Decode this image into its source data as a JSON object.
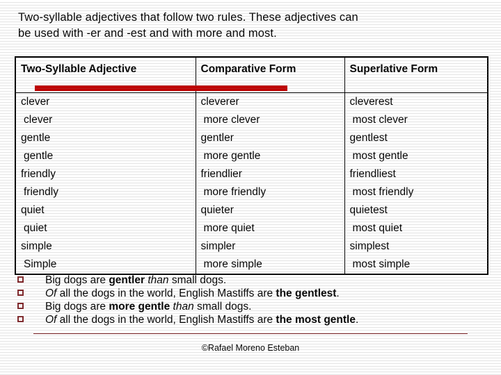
{
  "slide": {
    "title": "Two-syllable adjectives that follow two rules. These adjectives can\nbe used with -er and -est and with more and most.",
    "accent_red": "#C00000",
    "bullet_maroon": "#7F2629"
  },
  "table": {
    "headers": [
      "Two-Syllable Adjective",
      "Comparative Form",
      "Superlative Form"
    ],
    "rows": [
      {
        "adjective": "clever",
        "comparative": "cleverer",
        "superlative": "cleverest",
        "indent": false
      },
      {
        "adjective": "clever",
        "comparative": "more clever",
        "superlative": "most clever",
        "indent": true
      },
      {
        "adjective": "gentle",
        "comparative": "gentler",
        "superlative": "gentlest",
        "indent": false
      },
      {
        "adjective": "gentle",
        "comparative": "more gentle",
        "superlative": "most gentle",
        "indent": true
      },
      {
        "adjective": "friendly",
        "comparative": "friendlier",
        "superlative": "friendliest",
        "indent": false
      },
      {
        "adjective": "friendly",
        "comparative": "more friendly",
        "superlative": "most friendly",
        "indent": true
      },
      {
        "adjective": "quiet",
        "comparative": "quieter",
        "superlative": "quietest",
        "indent": false
      },
      {
        "adjective": "quiet",
        "comparative": "more quiet",
        "superlative": "most quiet",
        "indent": true
      },
      {
        "adjective": "simple",
        "comparative": "simpler",
        "superlative": "simplest",
        "indent": false
      },
      {
        "adjective": "Simple",
        "comparative": "more simple",
        "superlative": "most simple",
        "indent": true
      }
    ]
  },
  "highlight": {
    "type": "red-bar",
    "note": "red marker bar drawn over the first data row, spanning column 1 into column 2"
  },
  "bullets": [
    {
      "marker": "hollow-square",
      "parts": [
        {
          "text": "Big dogs are ",
          "style": "normal"
        },
        {
          "text": "gentler",
          "style": "bold"
        },
        {
          "text": " ",
          "style": "normal"
        },
        {
          "text": "than",
          "style": "italic"
        },
        {
          "text": " small dogs.",
          "style": "normal"
        }
      ]
    },
    {
      "marker": "hollow-square",
      "parts": [
        {
          "text": "Of",
          "style": "italic"
        },
        {
          "text": " all the dogs in the world, English Mastiffs are ",
          "style": "normal"
        },
        {
          "text": "the gentlest",
          "style": "bold"
        },
        {
          "text": ".",
          "style": "normal"
        }
      ]
    },
    {
      "marker": "hollow-square",
      "parts": [
        {
          "text": "Big dogs are ",
          "style": "normal"
        },
        {
          "text": "more gentle",
          "style": "bold"
        },
        {
          "text": " ",
          "style": "normal"
        },
        {
          "text": "than",
          "style": "italic"
        },
        {
          "text": " small dogs.",
          "style": "normal"
        }
      ]
    },
    {
      "marker": "hollow-square",
      "parts": [
        {
          "text": "Of",
          "style": "italic"
        },
        {
          "text": " all the dogs in the world, English Mastiffs are ",
          "style": "normal"
        },
        {
          "text": "the most gentle",
          "style": "bold"
        },
        {
          "text": ".",
          "style": "normal"
        }
      ]
    }
  ],
  "footer": {
    "credit": "©Rafael Moreno Esteban"
  }
}
